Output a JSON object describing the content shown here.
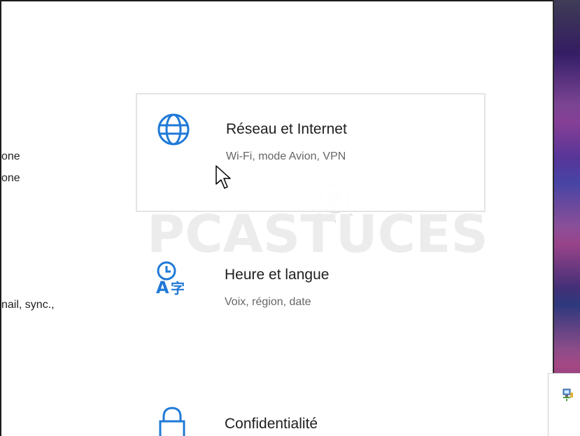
{
  "colors": {
    "accent_blue": "#1f79d7",
    "title_text": "#1e1e1e",
    "subtitle_text": "#666666",
    "selected_border": "#e4e4e4",
    "watermark_gray": "#d9d9d9"
  },
  "left_column": {
    "items": [
      {
        "label": "one"
      },
      {
        "label": "one"
      },
      {
        "label": "nail, sync.,"
      }
    ]
  },
  "tiles": [
    {
      "icon": "globe-icon",
      "title": "Réseau et Internet",
      "subtitle": "Wi-Fi, mode Avion, VPN"
    },
    {
      "icon": "time-language-icon",
      "title": "Heure et langue",
      "subtitle": "Voix, région, date"
    },
    {
      "icon": "lock-icon",
      "title": "Confidentialité",
      "subtitle": ""
    }
  ],
  "watermark": {
    "brand_text": "PCASTUCES"
  },
  "desktop": {
    "icon": "computer-network-icon"
  }
}
